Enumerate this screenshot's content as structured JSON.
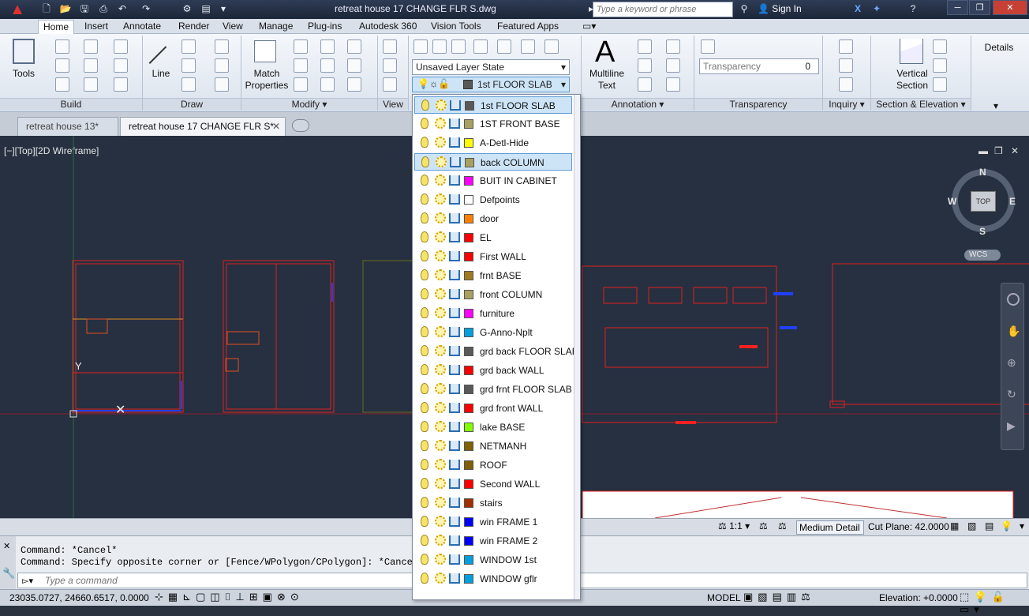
{
  "window": {
    "title": "retreat house 17 CHANGE FLR S.dwg",
    "search_placeholder": "Type a keyword or phrase",
    "sign_in": "Sign In"
  },
  "ribbon_tabs": [
    "Home",
    "Insert",
    "Annotate",
    "Render",
    "View",
    "Manage",
    "Plug-ins",
    "Autodesk 360",
    "Vision Tools",
    "Featured Apps"
  ],
  "active_tab": "Home",
  "panels": {
    "build": "Build",
    "draw": "Draw",
    "modify": "Modify",
    "view": "View",
    "annotation": "Annotation",
    "transparency": "Transparency",
    "inquiry": "Inquiry",
    "section": "Section & Elevation",
    "details": "Details"
  },
  "buttons": {
    "tools": "Tools",
    "line": "Line",
    "match_properties_1": "Match",
    "match_properties_2": "Properties",
    "multiline_1": "Multiline",
    "multiline_2": "Text",
    "vertical_section_1": "Vertical",
    "vertical_section_2": "Section"
  },
  "layer_state": "Unsaved Layer State",
  "current_layer": "1st FLOOR SLAB",
  "transparency": {
    "label": "Transparency",
    "value": "0"
  },
  "doc_tabs": [
    "retreat house 13*",
    "retreat house 17 CHANGE FLR S*"
  ],
  "viewport_label": "[−][Top][2D Wireframe]",
  "viewcube": {
    "top": "TOP",
    "n": "N",
    "s": "S",
    "e": "E",
    "w": "W",
    "wcs": "WCS"
  },
  "layers": [
    {
      "name": "1st FLOOR SLAB",
      "color": "#595959"
    },
    {
      "name": "1ST FRONT BASE",
      "color": "#a8a060"
    },
    {
      "name": "A-Detl-Hide",
      "color": "#ffff00"
    },
    {
      "name": "back COLUMN",
      "color": "#a8a060"
    },
    {
      "name": "BUIT IN CABINET",
      "color": "#ff00ff"
    },
    {
      "name": "Defpoints",
      "color": "#ffffff"
    },
    {
      "name": "door",
      "color": "#ff8000"
    },
    {
      "name": "EL",
      "color": "#ff0000"
    },
    {
      "name": "First WALL",
      "color": "#ff0000"
    },
    {
      "name": "frnt BASE",
      "color": "#a07a20"
    },
    {
      "name": "front COLUMN",
      "color": "#a8a060"
    },
    {
      "name": "furniture",
      "color": "#ff00ff"
    },
    {
      "name": "G-Anno-Nplt",
      "color": "#00a0e0"
    },
    {
      "name": "grd back FLOOR SLAB",
      "color": "#595959"
    },
    {
      "name": "grd back WALL",
      "color": "#ff0000"
    },
    {
      "name": "grd frnt FLOOR SLAB",
      "color": "#595959"
    },
    {
      "name": "grd front WALL",
      "color": "#ff0000"
    },
    {
      "name": "lake BASE",
      "color": "#80ff00"
    },
    {
      "name": "NETMANH",
      "color": "#806000"
    },
    {
      "name": "ROOF",
      "color": "#806000"
    },
    {
      "name": "Second WALL",
      "color": "#ff0000"
    },
    {
      "name": "stairs",
      "color": "#a03000"
    },
    {
      "name": "win FRAME 1",
      "color": "#0000ff"
    },
    {
      "name": "win FRAME 2",
      "color": "#0000ff"
    },
    {
      "name": "WINDOW 1st",
      "color": "#00a0e0"
    },
    {
      "name": "WINDOW gflr",
      "color": "#00a0e0"
    }
  ],
  "highlighted_layer_index": 3,
  "viewport_status": {
    "scale": "1:1",
    "detail": "Medium Detail",
    "cut_plane": "Cut Plane: 42.0000"
  },
  "command": {
    "line1": "Command: *Cancel*",
    "line2": "Command: Specify opposite corner or [Fence/WPolygon/CPolygon]: *Cancel*",
    "placeholder": "Type a command"
  },
  "statusbar": {
    "coords": "23035.0727, 24660.6517, 0.0000",
    "model": "MODEL",
    "elevation": "Elevation: +0.0000"
  }
}
